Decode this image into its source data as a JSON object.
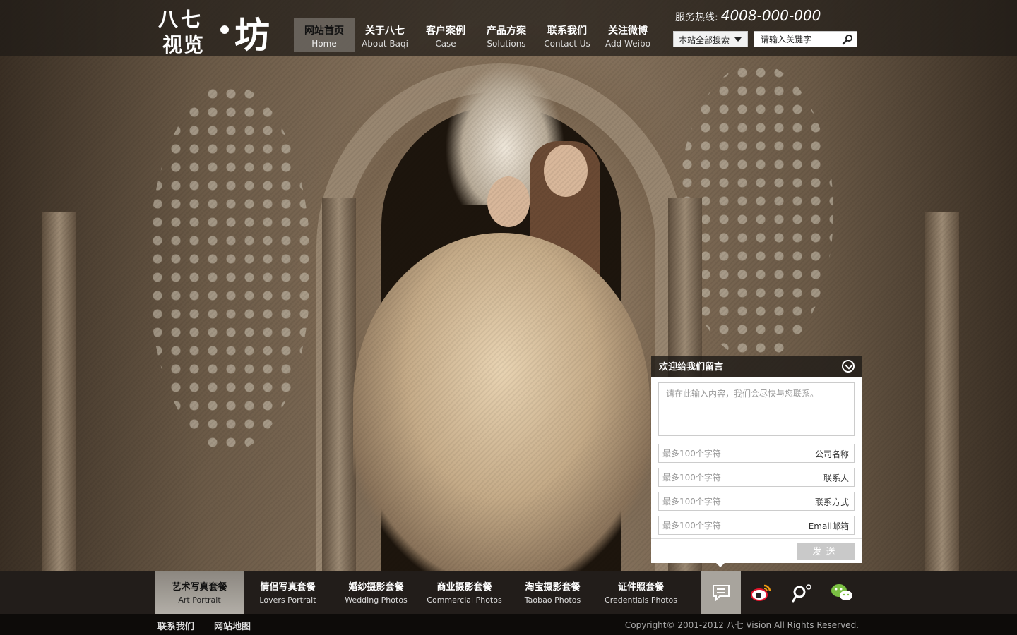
{
  "logo": {
    "line1": "八七",
    "line2": "视览",
    "line3": "坊"
  },
  "nav": [
    {
      "cn": "网站首页",
      "en": "Home"
    },
    {
      "cn": "关于八七",
      "en": "About Baqi"
    },
    {
      "cn": "客户案例",
      "en": "Case"
    },
    {
      "cn": "产品方案",
      "en": "Solutions"
    },
    {
      "cn": "联系我们",
      "en": "Contact Us"
    },
    {
      "cn": "关注微博",
      "en": "Add Weibo"
    }
  ],
  "hotline": {
    "label": "服务热线:",
    "number": "4008-000-000"
  },
  "search": {
    "scope": "本站全部搜索",
    "placeholder": "请输入关键字"
  },
  "message": {
    "title": "欢迎给我们留言",
    "content_placeholder": "请在此输入内容，我们会尽快与您联系。",
    "fields": [
      {
        "placeholder": "最多100个字符",
        "label": "公司名称"
      },
      {
        "placeholder": "最多100个字符",
        "label": "联系人"
      },
      {
        "placeholder": "最多100个字符",
        "label": "联系方式"
      },
      {
        "placeholder": "最多100个字符",
        "label": "Email邮箱"
      }
    ],
    "send_label": "发送"
  },
  "categories": [
    {
      "cn": "艺术写真套餐",
      "en": "Art Portrait"
    },
    {
      "cn": "情侣写真套餐",
      "en": "Lovers Portrait"
    },
    {
      "cn": "婚纱摄影套餐",
      "en": "Wedding Photos"
    },
    {
      "cn": "商业摄影套餐",
      "en": "Commercial Photos"
    },
    {
      "cn": "淘宝摄影套餐",
      "en": "Taobao Photos"
    },
    {
      "cn": "证件照套餐",
      "en": "Credentials Photos"
    }
  ],
  "social_icons": [
    "message-icon",
    "weibo-icon",
    "tencent-weibo-icon",
    "wechat-icon"
  ],
  "footer": {
    "links": [
      "联系我们",
      "网站地图"
    ],
    "copyright": "Copyright© 2001-2012 八七 Vision All Rights Reserved."
  }
}
